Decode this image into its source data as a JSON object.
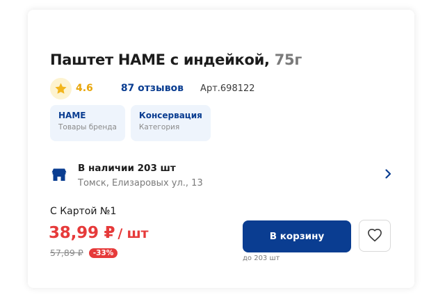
{
  "product": {
    "name": "Паштет HAME с индейкой,",
    "weight": "75г",
    "rating": "4.6",
    "reviews": "87 отзывов",
    "article": "Арт.698122"
  },
  "tags": [
    {
      "name": "HAME",
      "sub": "Товары бренда"
    },
    {
      "name": "Консервация",
      "sub": "Категория"
    }
  ],
  "stock": {
    "title": "В наличии 203 шт",
    "address": "Томск, Елизаровых ул., 13"
  },
  "pricing": {
    "card_label": "С Картой №1",
    "price": "38,99 ₽",
    "unit": "/ шт",
    "old_price": "57,89 ₽",
    "discount": "-33%"
  },
  "actions": {
    "cart_label": "В корзину",
    "cart_note": "до 203 шт"
  },
  "icons": {
    "rating": "star-icon",
    "stock": "store-icon",
    "stock_more": "chevron-right-icon",
    "favorite": "heart-icon"
  },
  "colors": {
    "brand_blue": "#0a3d91",
    "price_red": "#e63a3a",
    "rating_gold": "#f2b51c",
    "tag_bg": "#eef4fc"
  }
}
